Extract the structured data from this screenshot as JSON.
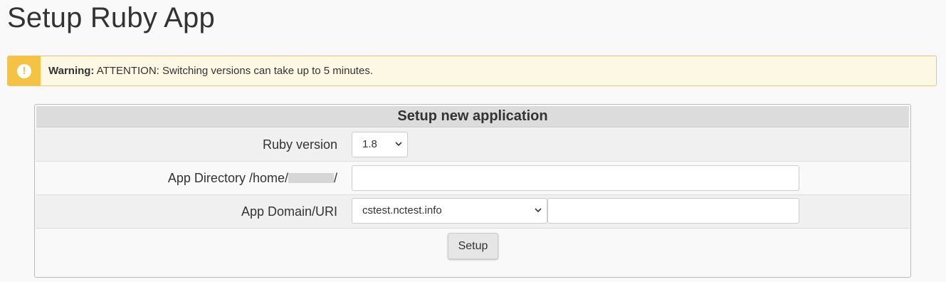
{
  "page": {
    "title": "Setup Ruby App"
  },
  "alert": {
    "icon": "exclamation-icon",
    "label": "Warning:",
    "message": "ATTENTION: Switching versions can take up to 5 minutes.",
    "accent_color": "#f5c344",
    "background_color": "#fcf8e3"
  },
  "form": {
    "header": "Setup new application",
    "ruby_version": {
      "label": "Ruby version",
      "selected": "1.8"
    },
    "app_directory": {
      "label_prefix": "App Directory /home/",
      "label_suffix": "/",
      "value": ""
    },
    "app_domain": {
      "label": "App Domain/URI",
      "selected_domain": "cstest.nctest.info",
      "path_value": ""
    },
    "submit_label": "Setup"
  }
}
